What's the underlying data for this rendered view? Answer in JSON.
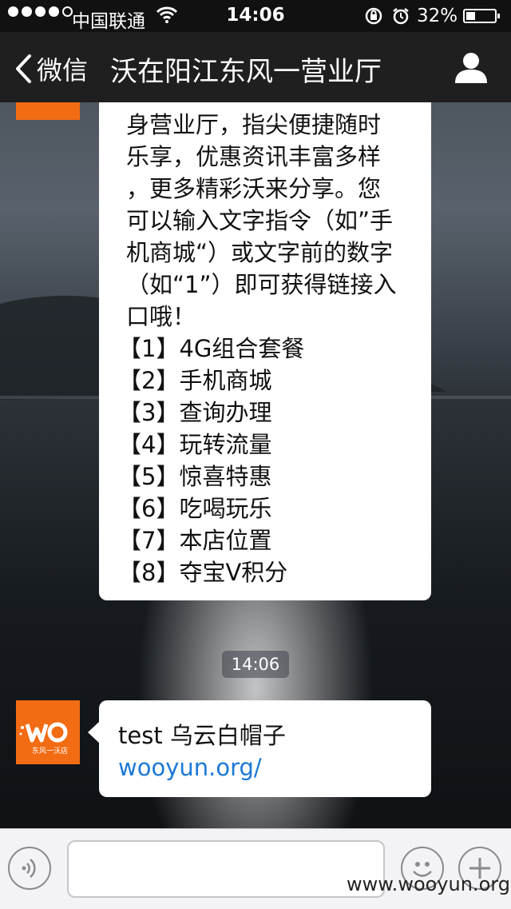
{
  "status_bar": {
    "carrier": "中国联通",
    "time": "14:06",
    "battery": "32%",
    "battery_level": 0.32,
    "signal_bars": 4,
    "icons": [
      "wifi-icon",
      "rotation-lock-icon",
      "alarm-icon",
      "battery-icon"
    ]
  },
  "nav": {
    "back_label": "微信",
    "title": "沃在阳江东风一营业厅",
    "back_icon": "chevron-left-icon",
    "profile_icon": "person-icon"
  },
  "messages": {
    "first": {
      "lines": [
        "身营业厅，指尖便捷随时",
        "乐享，优惠资讯丰富多样",
        "，更多精彩沃来分享。您",
        "可以输入文字指令（如”手",
        "机商城“）或文字前的数字",
        "（如“1”）即可获得链接入",
        "口哦！"
      ],
      "menu": [
        "【1】4G组合套餐",
        "【2】手机商城",
        "【3】查询办理",
        "【4】玩转流量",
        "【5】惊喜特惠",
        "【6】吃喝玩乐",
        "【7】本店位置",
        "【8】夺宝V积分"
      ]
    },
    "timestamp": "14:06",
    "second": {
      "text": "test 乌云白帽子",
      "link": "wooyun.org/"
    },
    "avatar": {
      "logo_text": "沃",
      "caption": "东风一沃店"
    }
  },
  "input_bar": {
    "placeholder": "",
    "icons": [
      "voice-icon",
      "emoji-icon",
      "plus-icon"
    ]
  },
  "watermark": "www.wooyun.org",
  "colors": {
    "brand_orange": "#f26c14",
    "link_blue": "#1b79d6",
    "nav_bg": "#1f1f1f"
  }
}
